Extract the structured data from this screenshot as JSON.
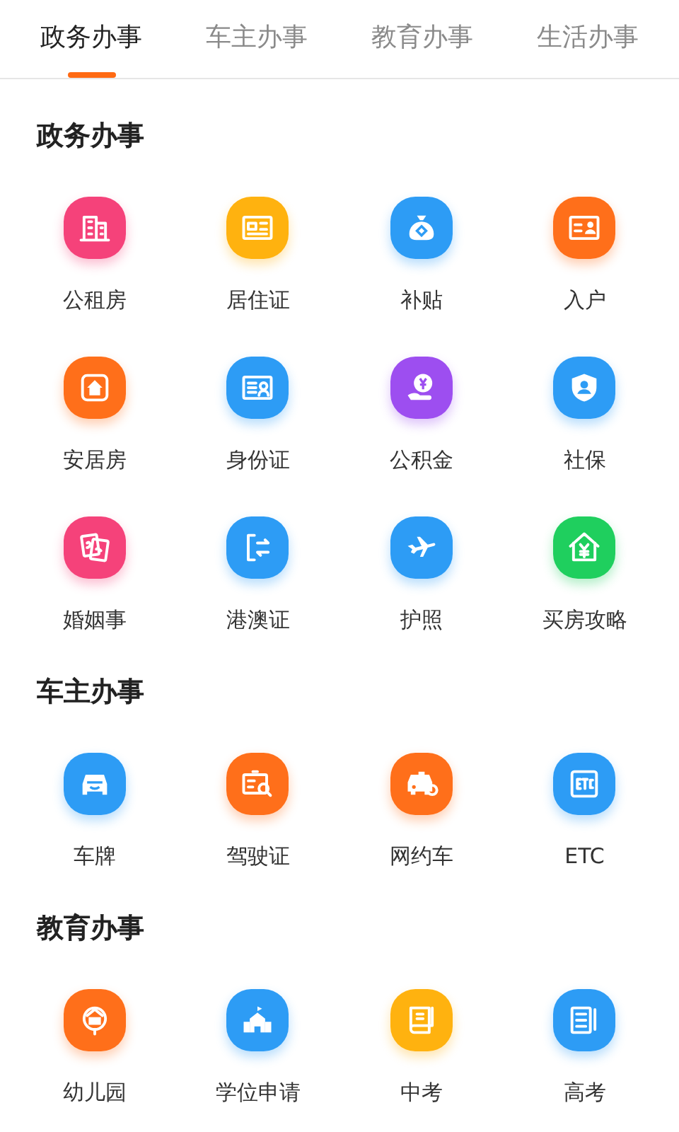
{
  "tabs": [
    {
      "label": "政务办事",
      "selected": true
    },
    {
      "label": "车主办事",
      "selected": false
    },
    {
      "label": "教育办事",
      "selected": false
    },
    {
      "label": "生活办事",
      "selected": false
    }
  ],
  "sections": [
    {
      "title": "政务办事",
      "items": [
        {
          "label": "公租房",
          "color": "#f5427a"
        },
        {
          "label": "居住证",
          "color": "#ffb20f"
        },
        {
          "label": "补贴",
          "color": "#2d9cf5"
        },
        {
          "label": "入户",
          "color": "#ff6f1a"
        },
        {
          "label": "安居房",
          "color": "#ff6f1a"
        },
        {
          "label": "身份证",
          "color": "#2d9cf5"
        },
        {
          "label": "公积金",
          "color": "#9d4ef0"
        },
        {
          "label": "社保",
          "color": "#2d9cf5"
        },
        {
          "label": "婚姻事",
          "color": "#f5427a"
        },
        {
          "label": "港澳证",
          "color": "#2d9cf5"
        },
        {
          "label": "护照",
          "color": "#2d9cf5"
        },
        {
          "label": "买房攻略",
          "color": "#1fcf5e"
        }
      ]
    },
    {
      "title": "车主办事",
      "items": [
        {
          "label": "车牌",
          "color": "#2d9cf5"
        },
        {
          "label": "驾驶证",
          "color": "#ff6f1a"
        },
        {
          "label": "网约车",
          "color": "#ff6f1a"
        },
        {
          "label": "ETC",
          "color": "#2d9cf5"
        }
      ]
    },
    {
      "title": "教育办事",
      "items": [
        {
          "label": "幼儿园",
          "color": "#ff6f1a"
        },
        {
          "label": "学位申请",
          "color": "#2d9cf5"
        },
        {
          "label": "中考",
          "color": "#ffb20f"
        },
        {
          "label": "高考",
          "color": "#2d9cf5"
        }
      ]
    }
  ]
}
